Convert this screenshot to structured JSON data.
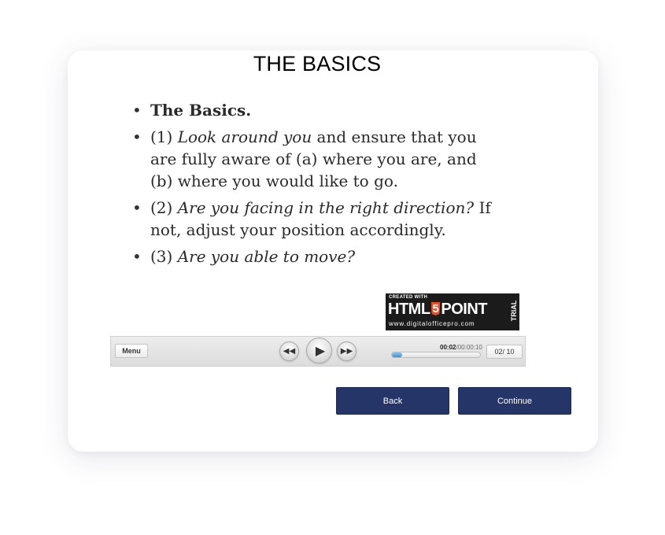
{
  "slide": {
    "title": "THE BASICS",
    "bullets": [
      {
        "bold": "The Basics."
      },
      {
        "pre": "(1) ",
        "italic": "Look around you",
        "post": " and ensure that you are fully aware of (a) where you are, and (b) where you would like to go."
      },
      {
        "pre": "(2) ",
        "italic": "Are you facing in the right direction?",
        "post": " If not, adjust your position accordingly."
      },
      {
        "pre": "(3) ",
        "italic": "Are you able to move?",
        "post": ""
      }
    ]
  },
  "badge": {
    "created_with": "CREATED WITH",
    "brand_left": "HTML",
    "brand_five": "5",
    "brand_right": "POINT",
    "url": "www.digitalofficepro.com",
    "trial": "TRIAL"
  },
  "player": {
    "menu_label": "Menu",
    "rewind_icon": "rewind-icon",
    "play_icon": "play-icon",
    "forward_icon": "fast-forward-icon",
    "time_current": "00:02",
    "time_total": "00:00:10",
    "progress_percent": 12,
    "page_indicator": "02/ 10"
  },
  "nav": {
    "back_label": "Back",
    "continue_label": "Continue"
  },
  "colors": {
    "nav_button": "#263568",
    "progress_fill": "#3b8fd3",
    "badge_bg": "#1b1b1b",
    "html5_orange": "#e34f26"
  }
}
